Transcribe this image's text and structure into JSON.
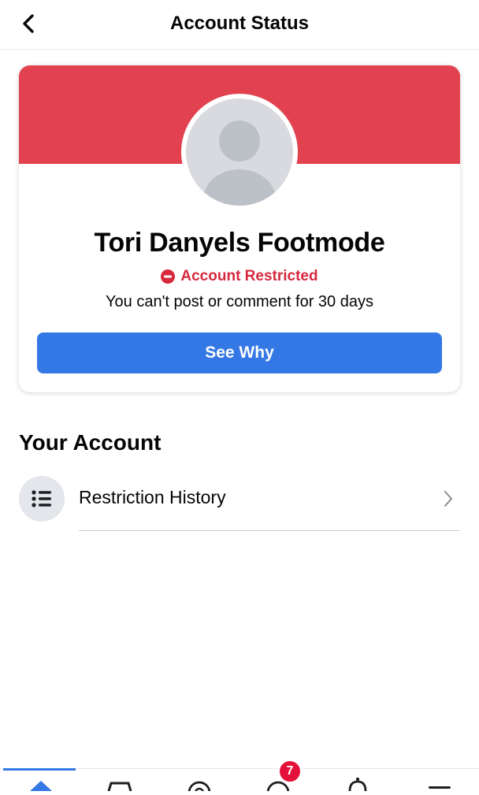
{
  "colors": {
    "banner": "#e2424f",
    "accent": "#3478e5",
    "restricted": "#d6293e",
    "text": "#050505",
    "icon": "#1c1e21",
    "badge": "#e4123a"
  },
  "header": {
    "title": "Account Status",
    "back_icon": "back-arrow-icon"
  },
  "card": {
    "profile_name": "Tori Danyels Footmode",
    "status_icon": "no-entry-icon",
    "status_label": "Account Restricted",
    "status_description": "You can't post or comment for 30 days",
    "button_label": "See Why"
  },
  "your_account": {
    "title": "Your Account",
    "items": [
      {
        "label": "Restriction History",
        "icon": "list-icon",
        "chevron": "chevron-right-icon"
      }
    ]
  },
  "tab_bar": {
    "tabs": [
      {
        "icon": "home-icon",
        "active": true
      },
      {
        "icon": "marketplace-icon"
      },
      {
        "icon": "watch-icon"
      },
      {
        "icon": "profile-icon",
        "badge": "7"
      },
      {
        "icon": "notifications-icon"
      },
      {
        "icon": "menu-icon"
      }
    ]
  }
}
